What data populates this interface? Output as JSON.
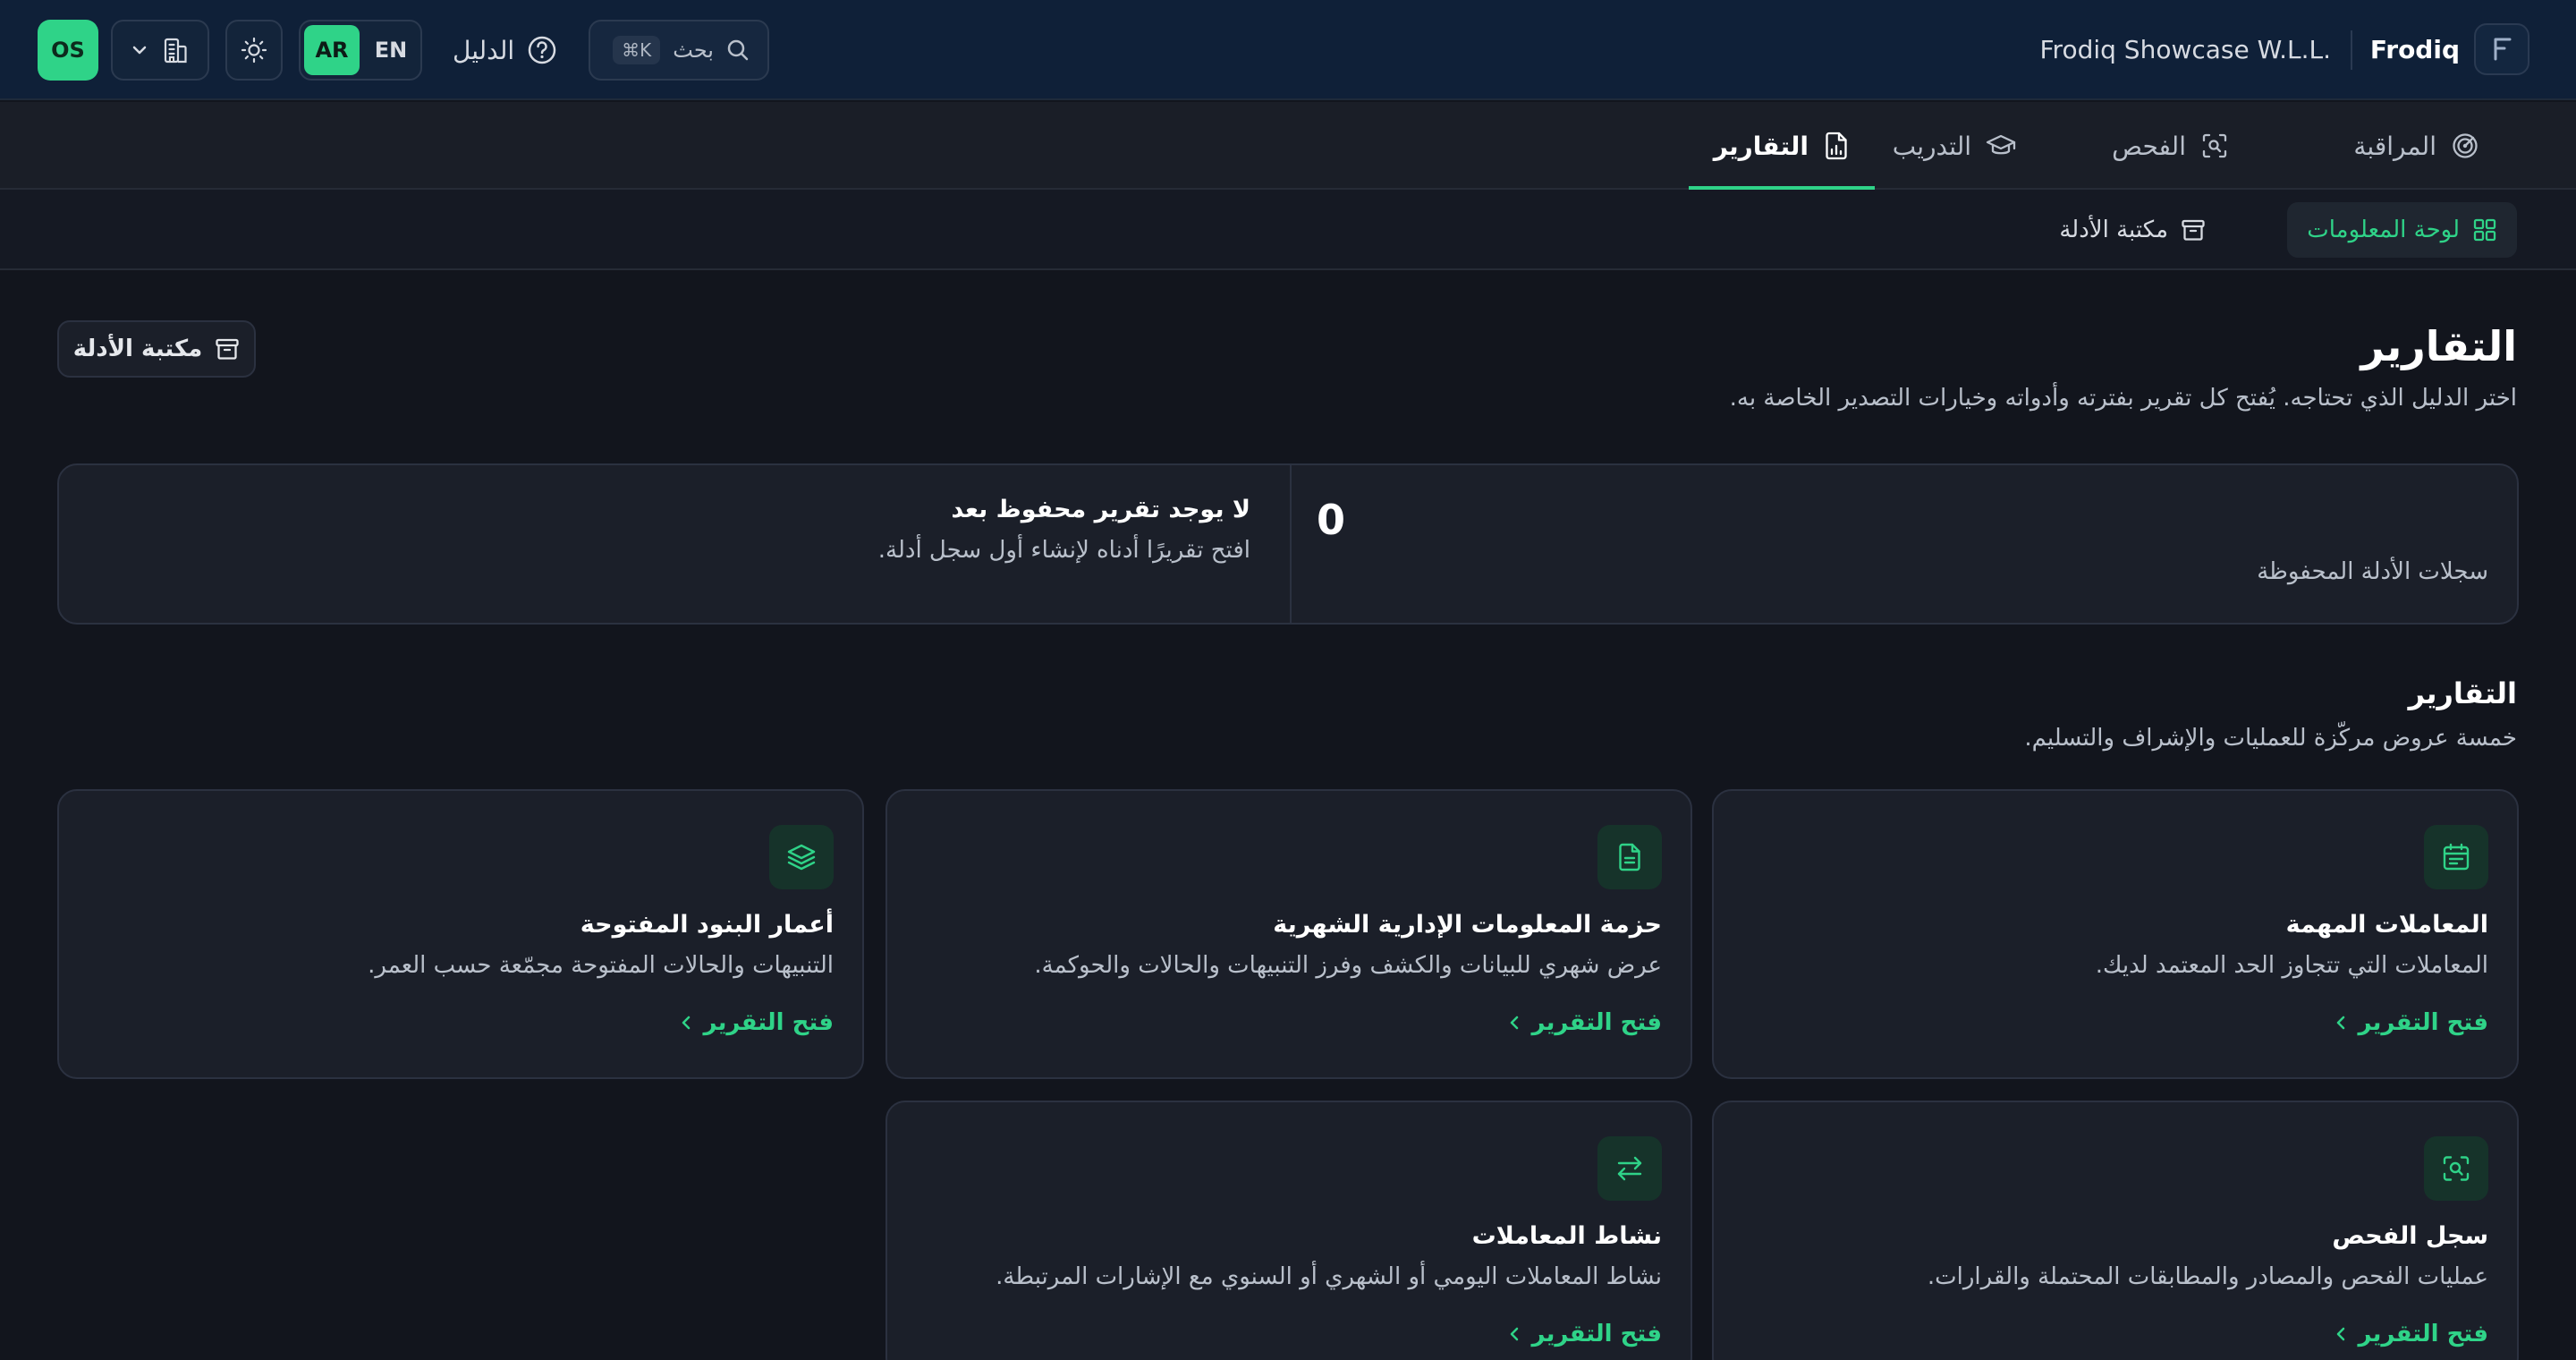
{
  "header": {
    "brand": "Frodiq",
    "company": "Frodiq Showcase W.L.L.",
    "search_label": "بحث",
    "search_shortcut": "⌘K",
    "guide_label": "الدليل",
    "lang_active": "AR",
    "lang_other": "EN",
    "avatar_initials": "OS"
  },
  "tabs": [
    {
      "label": "المراقبة",
      "icon": "radar-icon"
    },
    {
      "label": "الفحص",
      "icon": "scan-icon"
    },
    {
      "label": "التدريب",
      "icon": "graduation-cap-icon"
    },
    {
      "label": "التقارير",
      "icon": "report-file-icon",
      "active": true
    }
  ],
  "subnav": [
    {
      "label": "لوحة المعلومات",
      "icon": "grid-icon",
      "active": true
    },
    {
      "label": "مكتبة الأدلة",
      "icon": "archive-icon"
    }
  ],
  "page": {
    "title": "التقارير",
    "subtitle": "اختر الدليل الذي تحتاجه. يُفتح كل تقرير بفترته وأدواته وخيارات التصدير الخاصة به.",
    "library_button": "مكتبة الأدلة"
  },
  "summary": {
    "count": "0",
    "count_label": "سجلات الأدلة المحفوظة",
    "empty_title": "لا يوجد تقرير محفوظ بعد",
    "empty_sub": "افتح تقريرًا أدناه لإنشاء أول سجل أدلة."
  },
  "reports_section": {
    "title": "التقارير",
    "subtitle": "خمسة عروض مركّزة للعمليات والإشراف والتسليم."
  },
  "cards": [
    {
      "title": "المعاملات المهمة",
      "desc": "المعاملات التي تتجاوز الحد المعتمد لديك.",
      "link": "فتح التقرير",
      "icon": "calendar-icon"
    },
    {
      "title": "حزمة المعلومات الإدارية الشهرية",
      "desc": "عرض شهري للبيانات والكشف وفرز التنبيهات والحالات والحوكمة.",
      "link": "فتح التقرير",
      "icon": "document-icon"
    },
    {
      "title": "أعمار البنود المفتوحة",
      "desc": "التنبيهات والحالات المفتوحة مجمّعة حسب العمر.",
      "link": "فتح التقرير",
      "icon": "layers-icon"
    },
    {
      "title": "سجل الفحص",
      "desc": "عمليات الفحص والمصادر والمطابقات المحتملة والقرارات.",
      "link": "فتح التقرير",
      "icon": "scan-icon"
    },
    {
      "title": "نشاط المعاملات",
      "desc": "نشاط المعاملات اليومي أو الشهري أو السنوي مع الإشارات المرتبطة.",
      "link": "فتح التقرير",
      "icon": "arrows-exchange-icon"
    }
  ],
  "colors": {
    "accent": "#2fd388",
    "header_bg": "#0f2038",
    "page_bg": "#12151d",
    "card_bg": "#1b1f29"
  }
}
